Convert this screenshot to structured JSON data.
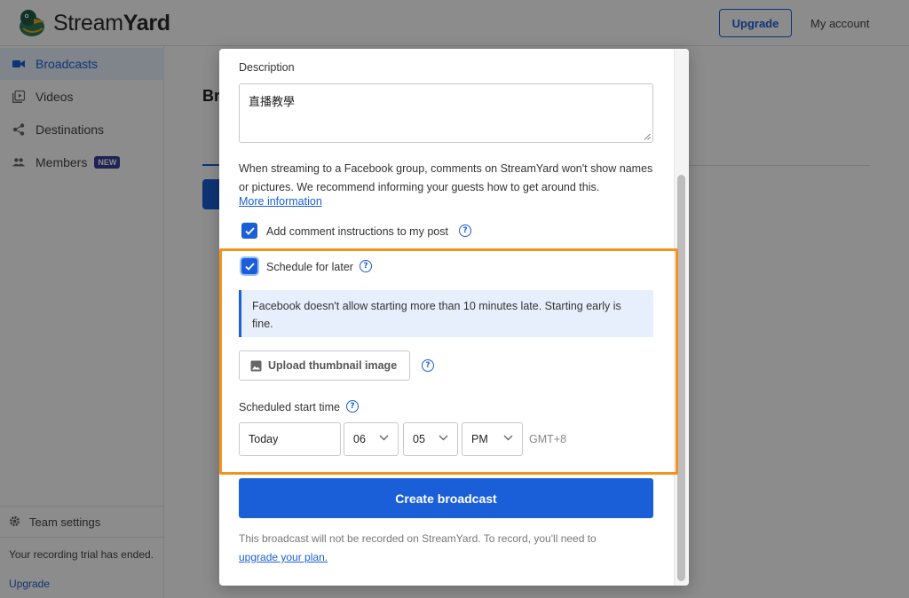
{
  "app": {
    "logo_text_regular": "Stream",
    "logo_text_bold": "Yard",
    "upgrade_label": "Upgrade",
    "account_label": "My account"
  },
  "sidebar": {
    "items": [
      {
        "label": "Broadcasts",
        "icon": "video-camera-icon",
        "active": true
      },
      {
        "label": "Videos",
        "icon": "video-library-icon",
        "active": false
      },
      {
        "label": "Destinations",
        "icon": "share-icon",
        "active": false
      },
      {
        "label": "Members",
        "icon": "people-icon",
        "active": false,
        "badge": "NEW"
      }
    ],
    "team_settings_label": "Team settings",
    "trial_text": "Your recording trial has ended.",
    "trial_link": "Upgrade"
  },
  "main": {
    "title_fragment": "Br"
  },
  "modal": {
    "description_label": "Description",
    "description_value": "直播教學",
    "notice_text": "When streaming to a Facebook group, comments on StreamYard won't show names or pictures. We recommend informing your guests how to get around this.",
    "more_info_label": "More information",
    "comment_instructions_label": "Add comment instructions to my post",
    "comment_instructions_checked": true,
    "schedule_label": "Schedule for later",
    "schedule_checked": true,
    "info_box_text": "Facebook doesn't allow starting more than 10 minutes late. Starting early is fine.",
    "thumbnail_button_label": "Upload thumbnail image",
    "start_time_label": "Scheduled start time",
    "date_value": "Today",
    "hour_value": "06",
    "minute_value": "05",
    "ampm_value": "PM",
    "timezone": "GMT+8",
    "create_button_label": "Create broadcast",
    "footer_text": "This broadcast will not be recorded on StreamYard. To record, you'll need to",
    "footer_link": "upgrade your plan."
  },
  "colors": {
    "accent": "#1a5fd8",
    "highlight": "#f5921e",
    "info_bg": "#e8effc",
    "badge_bg": "#3b3f99"
  }
}
